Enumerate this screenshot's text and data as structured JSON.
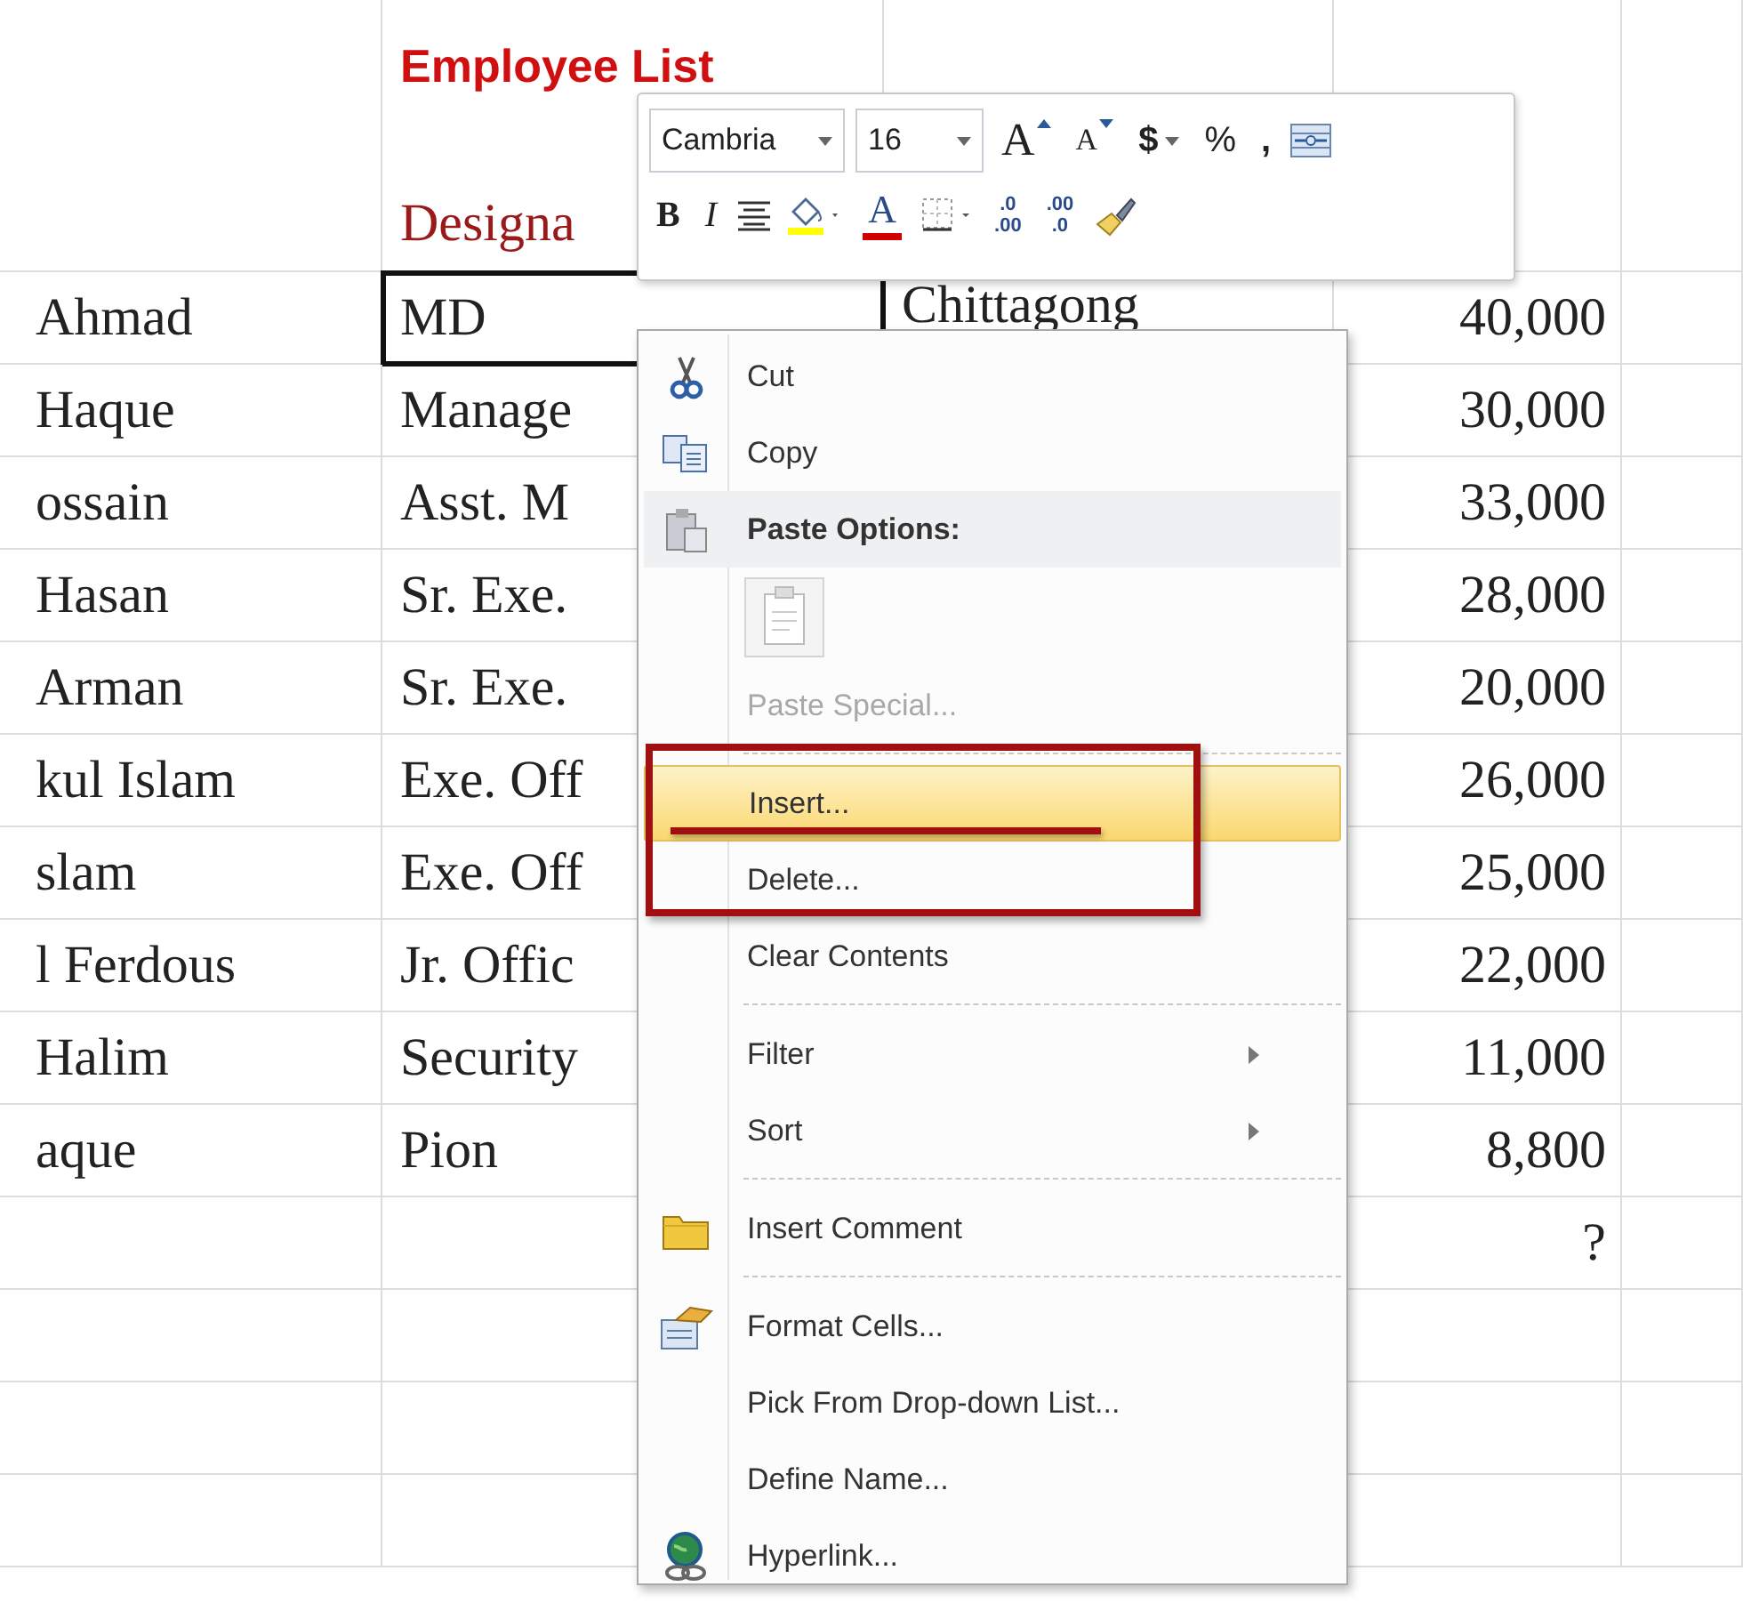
{
  "sheet": {
    "title": "Employee List",
    "header": "Designa",
    "rows": [
      {
        "name": "Ahmad",
        "designation": "MD",
        "location": "Chittagong",
        "salary": "40,000",
        "selected": true
      },
      {
        "name": "Haque",
        "designation": "Manage",
        "location": "",
        "salary": "30,000",
        "selected": false
      },
      {
        "name": "ossain",
        "designation": "Asst. M",
        "location": "",
        "salary": "33,000",
        "selected": false
      },
      {
        "name": "Hasan",
        "designation": "Sr. Exe.",
        "location": "",
        "salary": "28,000",
        "selected": false
      },
      {
        "name": "Arman",
        "designation": "Sr. Exe.",
        "location": "",
        "salary": "20,000",
        "selected": false
      },
      {
        "name": "kul Islam",
        "designation": "Exe. Off",
        "location": "",
        "salary": "26,000",
        "selected": false
      },
      {
        "name": "slam",
        "designation": "Exe. Off",
        "location": "",
        "salary": "25,000",
        "selected": false
      },
      {
        "name": "l Ferdous",
        "designation": "Jr. Offic",
        "location": "",
        "salary": "22,000",
        "selected": false
      },
      {
        "name": "Halim",
        "designation": "Security",
        "location": "",
        "salary": "11,000",
        "selected": false
      },
      {
        "name": "aque",
        "designation": "Pion",
        "location": "",
        "salary": "8,800",
        "selected": false
      },
      {
        "name": "",
        "designation": "",
        "location": "",
        "salary": "?",
        "selected": false
      }
    ]
  },
  "mini_toolbar": {
    "row1": [
      {
        "kind": "font_box",
        "value": "Cambria"
      },
      {
        "kind": "size_box",
        "value": "16"
      },
      {
        "kind": "grow_font",
        "label": "A"
      },
      {
        "kind": "shrink_font",
        "label": "A"
      },
      {
        "kind": "currency",
        "label": "$"
      },
      {
        "kind": "percent",
        "label": "%"
      },
      {
        "kind": "comma",
        "label": ","
      },
      {
        "kind": "merge"
      }
    ],
    "row2": [
      {
        "kind": "bold",
        "label": "B"
      },
      {
        "kind": "italic",
        "label": "I"
      },
      {
        "kind": "center"
      },
      {
        "kind": "fill_color",
        "color": "#ffff00"
      },
      {
        "kind": "font_color",
        "label": "A",
        "color": "#d00000"
      },
      {
        "kind": "borders"
      },
      {
        "kind": "increase_decimal",
        "lines": [
          ".0",
          ".00"
        ]
      },
      {
        "kind": "decrease_decimal",
        "lines": [
          ".00",
          ".0"
        ]
      },
      {
        "kind": "format_painter"
      }
    ]
  },
  "context_menu": {
    "items": [
      {
        "kind": "command",
        "label": "Cut",
        "selected": false,
        "disabled": false,
        "submenu": false
      },
      {
        "kind": "command",
        "label": "Copy",
        "selected": false,
        "disabled": false,
        "submenu": false
      },
      {
        "kind": "header",
        "label": "Paste Options:"
      },
      {
        "kind": "paste_icons"
      },
      {
        "kind": "command",
        "label": "Paste Special...",
        "selected": false,
        "disabled": true,
        "submenu": false
      },
      {
        "kind": "separator"
      },
      {
        "kind": "command",
        "label": "Insert...",
        "selected": true,
        "disabled": false,
        "submenu": false
      },
      {
        "kind": "command",
        "label": "Delete...",
        "selected": false,
        "disabled": false,
        "submenu": false
      },
      {
        "kind": "command",
        "label": "Clear Contents",
        "selected": false,
        "disabled": false,
        "submenu": false
      },
      {
        "kind": "separator"
      },
      {
        "kind": "command",
        "label": "Filter",
        "selected": false,
        "disabled": false,
        "submenu": true
      },
      {
        "kind": "command",
        "label": "Sort",
        "selected": false,
        "disabled": false,
        "submenu": true
      },
      {
        "kind": "separator"
      },
      {
        "kind": "command",
        "label": "Insert Comment",
        "selected": false,
        "disabled": false,
        "submenu": false
      },
      {
        "kind": "separator"
      },
      {
        "kind": "command",
        "label": "Format Cells...",
        "selected": false,
        "disabled": false,
        "submenu": false
      },
      {
        "kind": "command",
        "label": "Pick From Drop-down List...",
        "selected": false,
        "disabled": false,
        "submenu": false
      },
      {
        "kind": "command",
        "label": "Define Name...",
        "selected": false,
        "disabled": false,
        "submenu": false
      },
      {
        "kind": "command",
        "label": "Hyperlink...",
        "selected": false,
        "disabled": false,
        "submenu": false
      }
    ]
  }
}
